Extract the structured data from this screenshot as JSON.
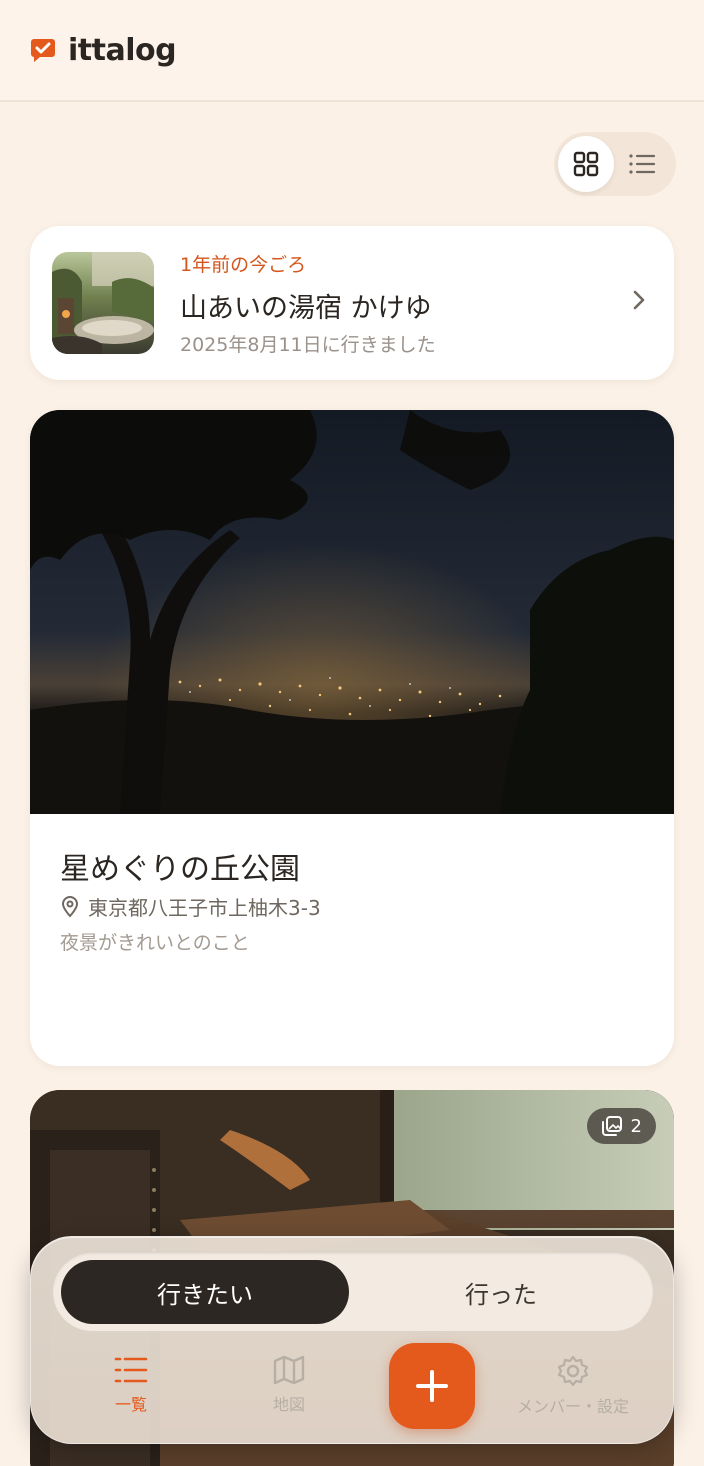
{
  "header": {
    "app_name": "ittalog"
  },
  "view_toggle": {
    "options": [
      "grid",
      "list"
    ],
    "selected": "grid"
  },
  "memory": {
    "eyebrow": "1年前の今ごろ",
    "title": "山あいの湯宿 かけゆ",
    "subtitle": "2025年8月11日に行きました"
  },
  "places": [
    {
      "title": "星めぐりの丘公園",
      "address": "東京都八王子市上柚木3-3",
      "note": "夜景がきれいとのこと"
    },
    {
      "photo_count": "2"
    }
  ],
  "segment": {
    "active_label": "行きたい",
    "inactive_label": "行った"
  },
  "tabs": {
    "list_label": "一覧",
    "map_label": "地図",
    "settings_label": "メンバー・設定"
  },
  "colors": {
    "accent": "#e45a1d",
    "background": "#fbf1e7",
    "dark": "#2d2723"
  }
}
